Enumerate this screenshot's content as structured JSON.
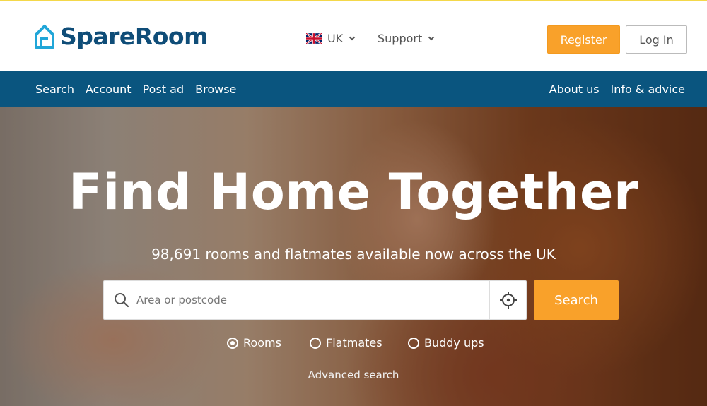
{
  "header": {
    "brand": "SpareRoom",
    "region": "UK",
    "support": "Support",
    "register": "Register",
    "login": "Log In"
  },
  "nav": {
    "left": [
      "Search",
      "Account",
      "Post ad",
      "Browse"
    ],
    "right": [
      "About us",
      "Info & advice"
    ]
  },
  "hero": {
    "title": "Find Home Together",
    "subtitle": "98,691 rooms and flatmates available now across the UK",
    "search_placeholder": "Area or postcode",
    "search_button": "Search",
    "options": [
      {
        "label": "Rooms",
        "selected": true
      },
      {
        "label": "Flatmates",
        "selected": false
      },
      {
        "label": "Buddy ups",
        "selected": false
      }
    ],
    "advanced": "Advanced search"
  },
  "colors": {
    "brand": "#0f4d78",
    "nav": "#0a557f",
    "accent": "#f9a12a",
    "logo_icon": "#21a6d8"
  }
}
